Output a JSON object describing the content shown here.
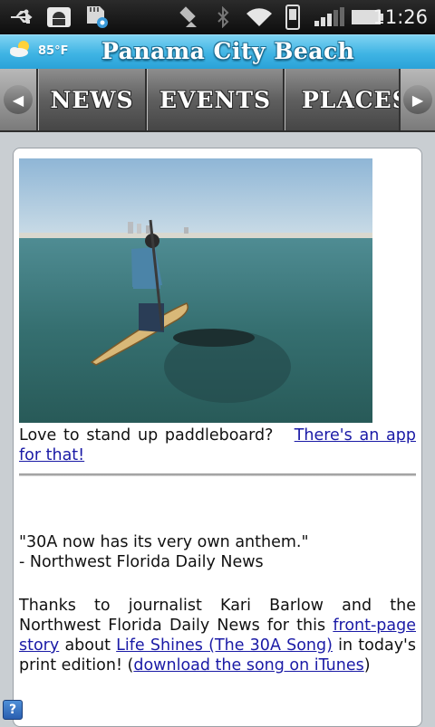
{
  "status_bar": {
    "time": "11:26",
    "icons": [
      "usb-icon",
      "android-debug-icon",
      "sd-card-icon",
      "satellite-icon",
      "bluetooth-icon",
      "wifi-icon",
      "phone-signal-icon",
      "battery-icon"
    ]
  },
  "title_bar": {
    "weather_temp": "85°F",
    "weather_icon": "partly-cloudy-icon",
    "city": "Panama City Beach"
  },
  "nav": {
    "tabs": [
      {
        "label": "NEWS"
      },
      {
        "label": "EVENTS"
      },
      {
        "label": "PLACES"
      }
    ]
  },
  "article": {
    "caption_text": "Love to stand up paddleboard?",
    "caption_link": "There's an app for that!",
    "quote": "\"30A now has its very own anthem.\"",
    "quote_source": "- Northwest Florida Daily News",
    "body_1": "Thanks to journalist Kari Barlow and the Northwest Florida Daily News for this",
    "link_1": "front-page story",
    "body_2": "about",
    "link_2": "Life Shines (The 30A Song)",
    "body_3": "in today's print edition! (",
    "link_3": "download the song on iTunes",
    "body_4": ")"
  },
  "colors": {
    "title_bar": "#3fb4e4",
    "link": "#1a1aa6",
    "nav": "#5c5c5c"
  },
  "help_button": "?"
}
